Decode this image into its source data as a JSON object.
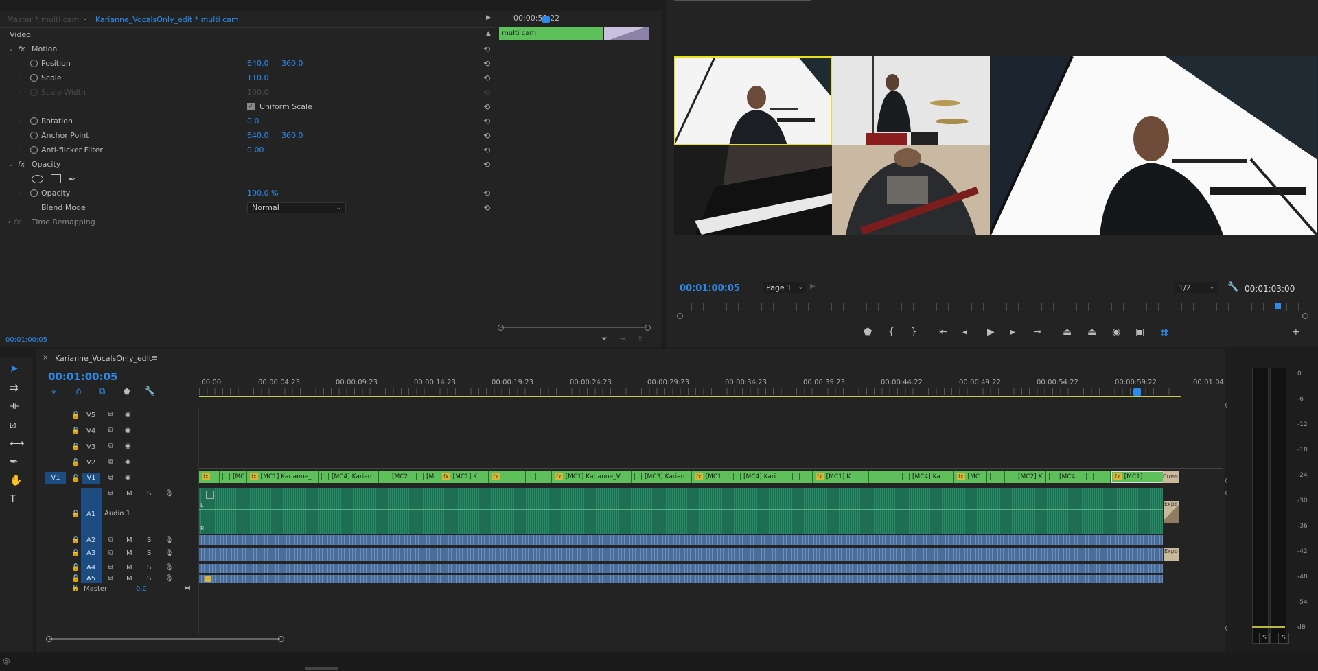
{
  "effect_controls": {
    "source_tab": "Master * multi cam",
    "active_tab": "Karianne_VocalsOnly_edit * multi cam",
    "section": "Video",
    "motion": "Motion",
    "position": {
      "label": "Position",
      "x": "640.0",
      "y": "360.0"
    },
    "scale": {
      "label": "Scale",
      "value": "110.0"
    },
    "scale_width": {
      "label": "Scale Width",
      "value": "100.0"
    },
    "uniform_scale": "Uniform Scale",
    "rotation": {
      "label": "Rotation",
      "value": "0.0"
    },
    "anchor_point": {
      "label": "Anchor Point",
      "x": "640.0",
      "y": "360.0"
    },
    "anti_flicker": {
      "label": "Anti-flicker Filter",
      "value": "0.00"
    },
    "opacity_group": "Opacity",
    "opacity": {
      "label": "Opacity",
      "value": "100.0 %"
    },
    "blend_mode": {
      "label": "Blend Mode",
      "value": "Normal"
    },
    "time_remapping": "Time Remapping",
    "mini_timecode": "00:00:59:22",
    "mini_clip": "multi cam",
    "footer_timecode": "00:01:00:05"
  },
  "program_monitor": {
    "timecode": "00:01:00:05",
    "page": "Page 1",
    "resolution": "1/2",
    "duration": "00:01:03:00"
  },
  "timeline": {
    "sequence_name": "Karianne_VocalsOnly_edit",
    "timecode": "00:01:00:05",
    "ruler": [
      ":00:00",
      "00:00:04:23",
      "00:00:09:23",
      "00:00:14:23",
      "00:00:19:23",
      "00:00:24:23",
      "00:00:29:23",
      "00:00:34:23",
      "00:00:39:23",
      "00:00:44:22",
      "00:00:49:22",
      "00:00:54:22",
      "00:00:59:22",
      "00:01:04:2"
    ],
    "video_tracks": [
      "V5",
      "V4",
      "V3",
      "V2",
      "V1"
    ],
    "source_patch_v": "V1",
    "audio_tracks": [
      "A1",
      "A2",
      "A3",
      "A4",
      "A5"
    ],
    "audio1_name": "Audio 1",
    "master": {
      "label": "Master",
      "value": "0.0"
    },
    "mute": "M",
    "solo": "S",
    "clips": [
      {
        "fx": "fx",
        "label": ""
      },
      {
        "fx": "",
        "label": "[MC"
      },
      {
        "fx": "fx",
        "label": "[MC1] Karianne_"
      },
      {
        "fx": "",
        "label": "[MC4] Karian"
      },
      {
        "fx": "",
        "label": "[MC2"
      },
      {
        "fx": "",
        "label": "[M"
      },
      {
        "fx": "fx",
        "label": "[MC1] K"
      },
      {
        "fx": "fx",
        "label": ""
      },
      {
        "fx": "",
        "label": ""
      },
      {
        "fx": "fx",
        "label": "[MC1] Karianne_V"
      },
      {
        "fx": "",
        "label": "[MC3] Karian"
      },
      {
        "fx": "fx",
        "label": "[MC1"
      },
      {
        "fx": "",
        "label": "[MC4] Kari"
      },
      {
        "fx": "",
        "label": ""
      },
      {
        "fx": "fx",
        "label": "[MC1] K"
      },
      {
        "fx": "",
        "label": ""
      },
      {
        "fx": "",
        "label": "[MC4] Ka"
      },
      {
        "fx": "fx",
        "label": "[MC"
      },
      {
        "fx": "",
        "label": ""
      },
      {
        "fx": "",
        "label": "[MC2] K"
      },
      {
        "fx": "",
        "label": "[MC4"
      },
      {
        "fx": "",
        "label": ""
      },
      {
        "fx": "fx",
        "label": "[MC1]"
      }
    ],
    "cross_label": "Cross",
    "expo_label": "Expo",
    "audio_channels": [
      "L",
      "R"
    ]
  },
  "meters": {
    "scale": [
      "0",
      "-6",
      "-12",
      "-18",
      "-24",
      "-30",
      "-36",
      "-42",
      "-48",
      "-54",
      "dB"
    ],
    "solo": [
      "S",
      "S"
    ]
  },
  "colors": {
    "accent": "#2d8ceb",
    "clip_green": "#5ec05a",
    "audio_green": "#1e7a5a",
    "audio_blue": "#4a6d9a",
    "fx_yellow": "#d9b53a"
  }
}
